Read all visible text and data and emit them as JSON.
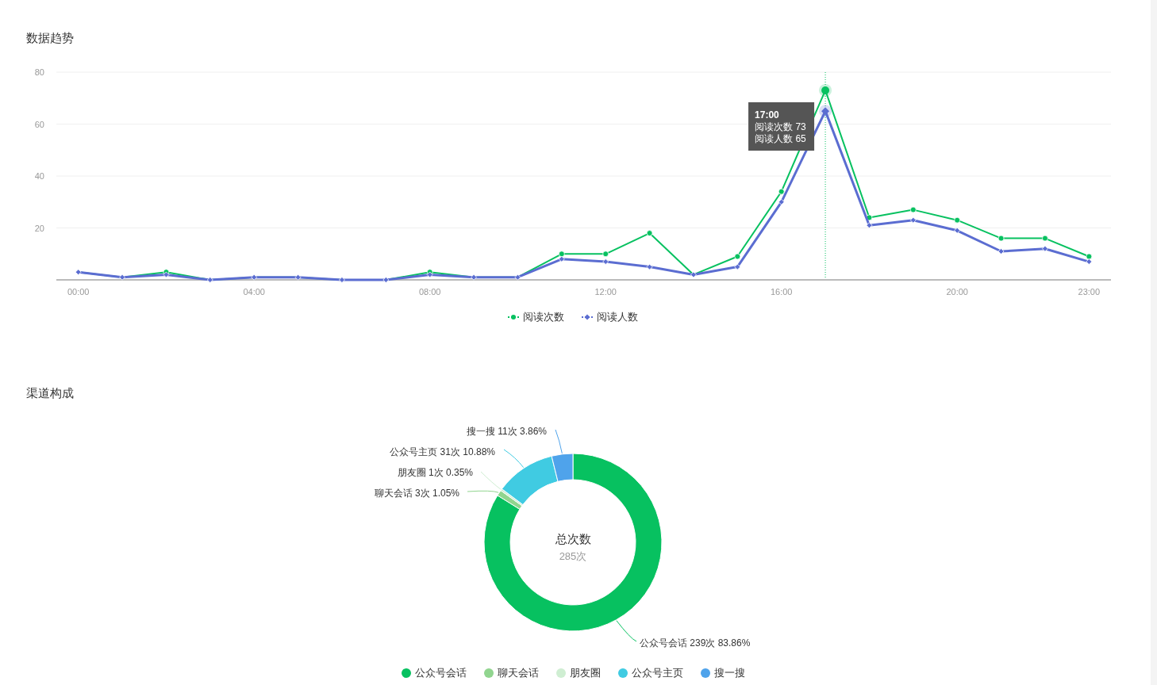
{
  "trend": {
    "title": "数据趋势",
    "chart_data": {
      "type": "line",
      "x": [
        0,
        1,
        2,
        3,
        4,
        5,
        6,
        7,
        8,
        9,
        10,
        11,
        12,
        13,
        14,
        15,
        16,
        17,
        18,
        19,
        20,
        21,
        22,
        23
      ],
      "series": [
        {
          "name": "阅读次数",
          "color": "#07c160",
          "marker": "circle",
          "values": [
            3,
            1,
            3,
            0,
            1,
            1,
            0,
            0,
            3,
            1,
            1,
            10,
            10,
            18,
            2,
            9,
            34,
            73,
            24,
            27,
            23,
            16,
            16,
            9
          ]
        },
        {
          "name": "阅读人数",
          "color": "#5b6dd1",
          "marker": "diamond",
          "values": [
            3,
            1,
            2,
            0,
            1,
            1,
            0,
            0,
            2,
            1,
            1,
            8,
            7,
            5,
            2,
            5,
            30,
            65,
            21,
            23,
            19,
            11,
            12,
            7
          ]
        }
      ],
      "ylim": [
        0,
        80
      ],
      "yticks": [
        20,
        40,
        60,
        80
      ],
      "grid": true,
      "xticks": [
        {
          "value": 0,
          "label": "00:00"
        },
        {
          "value": 4,
          "label": "04:00"
        },
        {
          "value": 8,
          "label": "08:00"
        },
        {
          "value": 12,
          "label": "12:00"
        },
        {
          "value": 16,
          "label": "16:00"
        },
        {
          "value": 20,
          "label": "20:00"
        },
        {
          "value": 23,
          "label": "23:00"
        }
      ],
      "xlim": [
        -0.5,
        23.5
      ],
      "ref_lines": [
        {
          "axis": "x",
          "value": 17
        }
      ]
    },
    "tooltip": {
      "title": "17:00",
      "lines": [
        "阅读次数 73",
        "阅读人数 65"
      ]
    }
  },
  "channels": {
    "title": "渠道构成",
    "chart_data": {
      "type": "donut",
      "categories": [
        "公众号会话",
        "聊天会话",
        "朋友圈",
        "公众号主页",
        "搜一搜"
      ],
      "values": [
        239,
        3,
        1,
        31,
        11
      ],
      "value_labels": [
        "公众号会话 239次 83.86%",
        "聊天会话 3次 1.05%",
        "朋友圈 1次 0.35%",
        "公众号主页 31次 10.88%",
        "搜一搜 11次 3.86%"
      ]
    },
    "center_title": "总次数",
    "center_value": "285次",
    "legend": [
      {
        "color": "#07c160"
      },
      {
        "color": "#91d58f"
      },
      {
        "color": "#cfeed2"
      },
      {
        "color": "#40cbe2"
      },
      {
        "color": "#4fa3eb"
      }
    ]
  }
}
